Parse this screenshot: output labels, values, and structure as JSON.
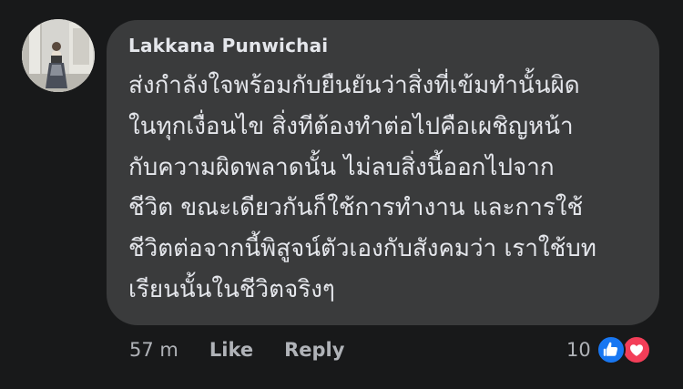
{
  "comment": {
    "author": "Lakkana Punwichai",
    "lines": [
      "ส่งกำลังใจพร้อมกับยืนยันว่าสิ่งที่เข้มทำนั้นผิด",
      "ในทุกเงื่อนไข สิ่งทีต้องทำต่อไปคือเผชิญหน้า",
      "กับความผิดพลาดนั้น ไม่ลบสิ่งนี้ออกไปจาก",
      "ชีวิต ขณะเดียวกันก็ใช้การทำงาน และการใช้",
      "ชีวิตต่อจากนี้พิสูจน์ตัวเองกับสังคมว่า เราใช้บท",
      "เรียนนั้นในชีวิตจริงๆ"
    ]
  },
  "actions": {
    "time": "57 m",
    "like_label": "Like",
    "reply_label": "Reply"
  },
  "reactions": {
    "count": "10",
    "icons": [
      "like-icon",
      "love-icon"
    ]
  },
  "colors": {
    "background": "#18191a",
    "bubble": "#3a3b3c",
    "text_primary": "#e4e6eb",
    "text_secondary": "#b0b3b8",
    "like_blue": "#1877f2",
    "love_red": "#f33e58"
  }
}
